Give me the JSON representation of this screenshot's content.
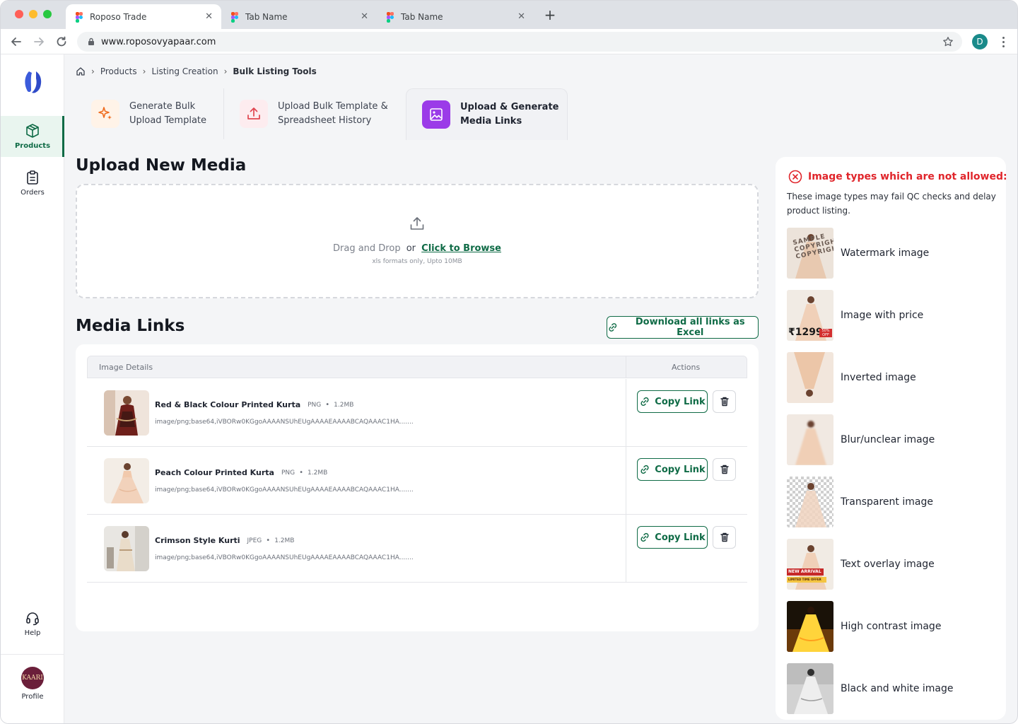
{
  "browser": {
    "tabs": [
      {
        "title": "Roposo Trade",
        "active": true
      },
      {
        "title": "Tab Name",
        "active": false
      },
      {
        "title": "Tab Name",
        "active": false
      }
    ],
    "url": "www.roposovyapaar.com",
    "profile_initial": "D"
  },
  "sidenav": {
    "items": [
      {
        "label": "Products",
        "icon": "box-icon",
        "active": true
      },
      {
        "label": "Orders",
        "icon": "clipboard-icon",
        "active": false
      },
      {
        "label": "Help",
        "icon": "headset-icon",
        "active": false
      },
      {
        "label": "Profile",
        "icon": "avatar",
        "active": false
      }
    ],
    "profile_logo_text": "KAARI"
  },
  "breadcrumb": {
    "items": [
      "Products",
      "Listing Creation",
      "Bulk Listing Tools"
    ]
  },
  "page_tabs": [
    {
      "line1": "Generate Bulk",
      "line2": "Upload Template",
      "active": false
    },
    {
      "line1": "Upload Bulk Template &",
      "line2": "Spreadsheet History",
      "active": false
    },
    {
      "line1": "Upload & Generate",
      "line2": "Media Links",
      "active": true
    }
  ],
  "upload": {
    "title": "Upload New Media",
    "drag_text": "Drag and Drop",
    "or_text": "or",
    "browse_text": "Click to Browse",
    "hint": "xls formats only, Upto 10MB"
  },
  "media_links": {
    "title": "Media Links",
    "download_label": "Download all links as Excel",
    "columns": [
      "Image Details",
      "Actions"
    ],
    "copy_label": "Copy Link",
    "rows": [
      {
        "name": "Red & Black Colour Printed Kurta",
        "format": "PNG",
        "size": "1.2MB",
        "path": "image/png;base64,iVBORw0KGgoAAAANSUhEUgAAAAEAAAABCAQAAAC1HA......."
      },
      {
        "name": "Peach Colour Printed Kurta",
        "format": "PNG",
        "size": "1.2MB",
        "path": "image/png;base64,iVBORw0KGgoAAAANSUhEUgAAAAEAAAABCAQAAAC1HA......."
      },
      {
        "name": "Crimson Style Kurti",
        "format": "JPEG",
        "size": "1.2MB",
        "path": "image/png;base64,iVBORw0KGgoAAAANSUhEUgAAAAEAAAABCAQAAAC1HA......."
      }
    ]
  },
  "not_allowed": {
    "title": "Image types which are not allowed:",
    "description": "These image types may fail QC checks and delay product listing.",
    "items": [
      {
        "label": "Watermark image",
        "overlay": "SAMPLE COPYRIGHT COPYRIGHT"
      },
      {
        "label": "Image with price",
        "overlay": "₹1299",
        "badge": "50% OFF"
      },
      {
        "label": "Inverted image"
      },
      {
        "label": "Blur/unclear image"
      },
      {
        "label": "Transparent image"
      },
      {
        "label": "Text overlay image",
        "overlay": "NEW ARRIVAL",
        "overlay2": "LIMITED TIME OFFER"
      },
      {
        "label": "High contrast image"
      },
      {
        "label": "Black and white image"
      }
    ]
  },
  "colors": {
    "brand_green": "#0f6b46",
    "error_red": "#e0252b",
    "active_tab_icon": "#9b3be8",
    "logo_blue": "#3b5bdb"
  }
}
